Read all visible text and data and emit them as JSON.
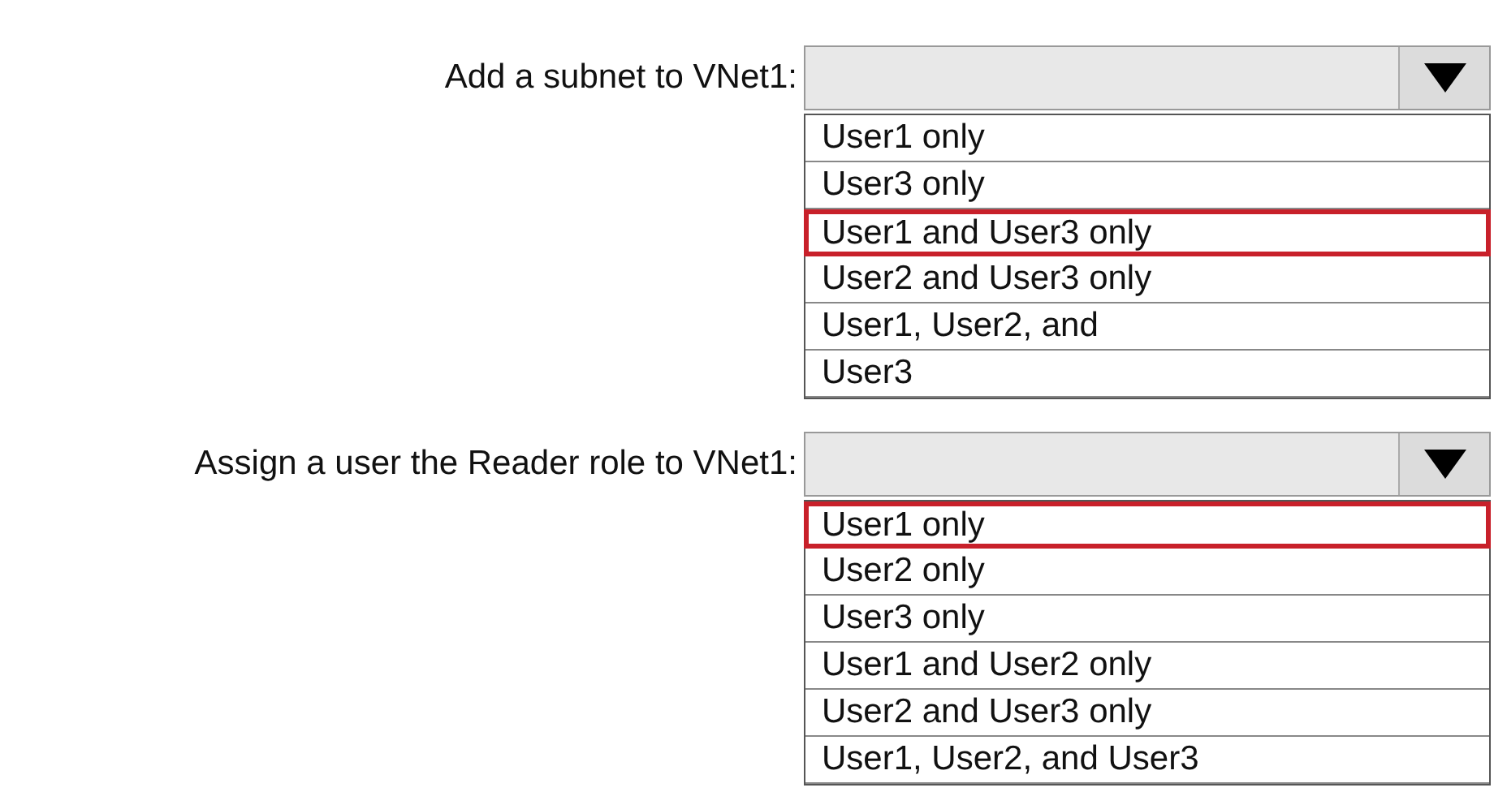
{
  "questions": [
    {
      "label": "Add a subnet to VNet1:",
      "options": [
        {
          "text": "User1 only",
          "selected": false
        },
        {
          "text": "User3 only",
          "selected": false
        },
        {
          "text": "User1 and User3 only",
          "selected": true
        },
        {
          "text": "User2 and User3 only",
          "selected": false
        },
        {
          "text": "User1, User2, and",
          "selected": false
        },
        {
          "text": "User3",
          "selected": false
        }
      ]
    },
    {
      "label": "Assign a user the Reader role to VNet1:",
      "options": [
        {
          "text": "User1 only",
          "selected": true
        },
        {
          "text": "User2 only",
          "selected": false
        },
        {
          "text": "User3 only",
          "selected": false
        },
        {
          "text": "User1 and User2 only",
          "selected": false
        },
        {
          "text": "User2 and User3 only",
          "selected": false
        },
        {
          "text": "User1, User2, and User3",
          "selected": false
        }
      ]
    }
  ]
}
